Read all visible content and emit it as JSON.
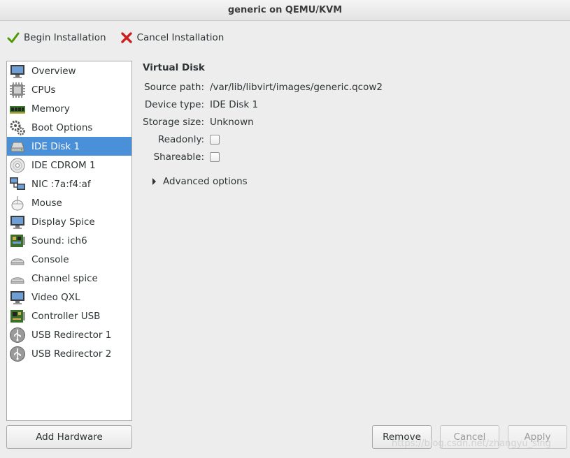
{
  "window": {
    "title": "generic on QEMU/KVM"
  },
  "toolbar": {
    "begin_label": "Begin Installation",
    "cancel_label": "Cancel Installation"
  },
  "sidebar": {
    "items": [
      {
        "label": "Overview",
        "icon": "monitor-icon"
      },
      {
        "label": "CPUs",
        "icon": "cpu-icon"
      },
      {
        "label": "Memory",
        "icon": "memory-icon"
      },
      {
        "label": "Boot Options",
        "icon": "gears-icon"
      },
      {
        "label": "IDE Disk 1",
        "icon": "disk-icon",
        "selected": true
      },
      {
        "label": "IDE CDROM 1",
        "icon": "cdrom-icon"
      },
      {
        "label": "NIC :7a:f4:af",
        "icon": "network-icon"
      },
      {
        "label": "Mouse",
        "icon": "mouse-icon"
      },
      {
        "label": "Display Spice",
        "icon": "display-icon"
      },
      {
        "label": "Sound: ich6",
        "icon": "sound-card-icon"
      },
      {
        "label": "Console",
        "icon": "serial-console-icon"
      },
      {
        "label": "Channel spice",
        "icon": "channel-icon"
      },
      {
        "label": "Video QXL",
        "icon": "video-icon"
      },
      {
        "label": "Controller USB",
        "icon": "controller-card-icon"
      },
      {
        "label": "USB Redirector 1",
        "icon": "usb-icon"
      },
      {
        "label": "USB Redirector 2",
        "icon": "usb-icon"
      }
    ],
    "add_hardware_label": "Add Hardware"
  },
  "details": {
    "section_title": "Virtual Disk",
    "source_path_label": "Source path:",
    "source_path_value": "/var/lib/libvirt/images/generic.qcow2",
    "device_type_label": "Device type:",
    "device_type_value": "IDE Disk 1",
    "storage_size_label": "Storage size:",
    "storage_size_value": "Unknown",
    "readonly_label": "Readonly:",
    "readonly_checked": false,
    "shareable_label": "Shareable:",
    "shareable_checked": false,
    "advanced_label": "Advanced options"
  },
  "footer": {
    "remove_label": "Remove",
    "cancel_label": "Cancel",
    "apply_label": "Apply"
  },
  "watermark": "https://blog.csdn.net/zhangyu_sing"
}
